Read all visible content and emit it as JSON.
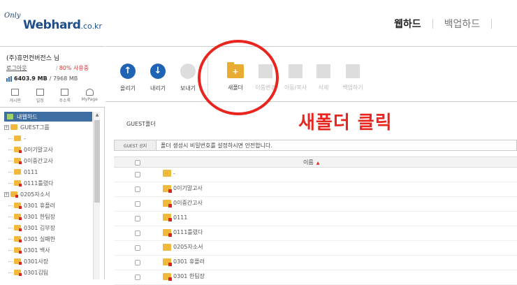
{
  "header": {
    "logo_only": "Only",
    "logo_brand": "Webhard",
    "logo_tld": ".co.kr",
    "nav": [
      "웹하드",
      "백업하드"
    ]
  },
  "user": {
    "name": "(주)휴먼컨버전스 님",
    "logout": "로그아웃",
    "usage_percent": "80% 사용중",
    "used": "6403.9 MB",
    "total": "/ 7968 MB",
    "icons": [
      {
        "label": "게시판",
        "icon": "board-icon"
      },
      {
        "label": "일정",
        "icon": "calendar-icon"
      },
      {
        "label": "주소록",
        "icon": "addressbook-icon"
      },
      {
        "label": "MyPage",
        "icon": "user-icon"
      }
    ]
  },
  "tree": {
    "header": "내웹하드",
    "items": [
      {
        "label": "GUEST그룹",
        "level": 0,
        "expander": "+",
        "red": false
      },
      {
        "label": "-",
        "level": 1,
        "red": false
      },
      {
        "label": "0이기말고사",
        "level": 1,
        "red": true
      },
      {
        "label": "0이중간고사",
        "level": 1,
        "red": true
      },
      {
        "label": "0111",
        "level": 1,
        "red": false
      },
      {
        "label": "0111틀렸다",
        "level": 1,
        "red": true
      },
      {
        "label": "0205자소서",
        "level": 0,
        "expander": "+",
        "red": true
      },
      {
        "label": "0301 휴플러",
        "level": 1,
        "red": true
      },
      {
        "label": "0301 한팀장",
        "level": 1,
        "red": true
      },
      {
        "label": "0301 김부장",
        "level": 1,
        "red": true
      },
      {
        "label": "0301 실패한",
        "level": 1,
        "red": true
      },
      {
        "label": "0301 백사",
        "level": 1,
        "red": true
      },
      {
        "label": "0301사장",
        "level": 1,
        "red": true
      },
      {
        "label": "0301김팀",
        "level": 1,
        "red": true
      }
    ]
  },
  "toolbar": {
    "upload": "올리기",
    "download": "내리기",
    "send": "보내기",
    "new_folder": "새폴더",
    "rename": "이름변경",
    "move_copy": "이동/복사",
    "delete": "삭제",
    "backup": "백업하기"
  },
  "main": {
    "path": "GUEST폴더",
    "annotation": "새폴더 클릭",
    "notice_label": "GUEST 공지",
    "notice_text": "폴더 생성시 비밀번호를 설정하시면 안전합니다.",
    "column_name": "이름",
    "files": [
      {
        "name": "-",
        "red": false
      },
      {
        "name": "0이기말고사",
        "red": true
      },
      {
        "name": "0이중간고사",
        "red": true
      },
      {
        "name": "0111",
        "red": true
      },
      {
        "name": "0111틀렸다",
        "red": true
      },
      {
        "name": "0205자소서",
        "red": false
      },
      {
        "name": "0301 휴플러",
        "red": true
      },
      {
        "name": "0301 한팀장",
        "red": true
      }
    ]
  },
  "colors": {
    "brand": "#1f4e8c",
    "accent_blue": "#1f63b5",
    "annotation_red": "#e8261f",
    "folder": "#f0b93c"
  }
}
